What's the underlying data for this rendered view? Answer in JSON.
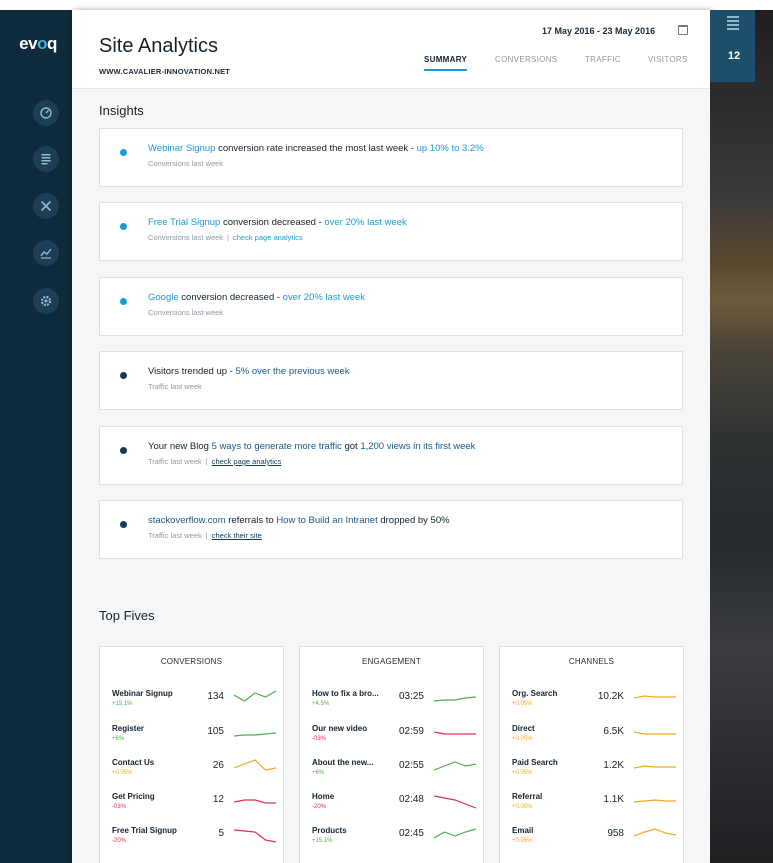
{
  "brand": {
    "logo_a": "ev",
    "logo_o": "o",
    "logo_b": "q"
  },
  "header": {
    "title": "Site Analytics",
    "site_url": "WWW.CAVALIER-INNOVATION.NET",
    "date_range": "17 May 2016 - 23 May 2016",
    "tabs": [
      {
        "label": "SUMMARY",
        "active": true
      },
      {
        "label": "CONVERSIONS",
        "active": false
      },
      {
        "label": "TRAFFIC",
        "active": false
      },
      {
        "label": "VISITORS",
        "active": false
      }
    ]
  },
  "sidebar": {
    "icons": [
      "dashboard-icon",
      "document-list-icon",
      "tools-icon",
      "analytics-chart-icon",
      "settings-gear-icon"
    ]
  },
  "insights": {
    "title": "Insights",
    "cards": [
      {
        "bullet": "light",
        "parts": [
          {
            "t": "Webinar Signup",
            "c": "hl-l"
          },
          {
            "t": " conversion rate increased the most last week - ",
            "c": ""
          },
          {
            "t": "up 10% to 3.2%",
            "c": "hl-l"
          }
        ],
        "sub": "Conversions last week",
        "link": "",
        "link_style": ""
      },
      {
        "bullet": "light",
        "parts": [
          {
            "t": "Free Trial Signup",
            "c": "hl-l"
          },
          {
            "t": " conversion decreased - ",
            "c": ""
          },
          {
            "t": "over 20% last week",
            "c": "hl-l"
          }
        ],
        "sub": "Conversions last week",
        "link": "check page analytics",
        "link_style": "link-l"
      },
      {
        "bullet": "light",
        "parts": [
          {
            "t": "Google",
            "c": "hl-l"
          },
          {
            "t": " conversion decreased - ",
            "c": ""
          },
          {
            "t": "over 20% last week",
            "c": "hl-l"
          }
        ],
        "sub": "Conversions last week",
        "link": "",
        "link_style": ""
      },
      {
        "bullet": "dark",
        "parts": [
          {
            "t": "Visitors trended up - ",
            "c": ""
          },
          {
            "t": "5% over the previous week",
            "c": "hl-d"
          }
        ],
        "sub": "Traffic last week",
        "link": "",
        "link_style": ""
      },
      {
        "bullet": "dark",
        "parts": [
          {
            "t": "Your new Blog ",
            "c": ""
          },
          {
            "t": "5 ways to generate more traffic",
            "c": "hl-d"
          },
          {
            "t": " got ",
            "c": ""
          },
          {
            "t": "1,200 views in its first week",
            "c": "hl-d"
          }
        ],
        "sub": "Traffic last week",
        "link": "check page analytics",
        "link_style": "link-d"
      },
      {
        "bullet": "dark",
        "parts": [
          {
            "t": "stackoverflow.com",
            "c": "hl-d"
          },
          {
            "t": " referrals to ",
            "c": ""
          },
          {
            "t": "How to Build an Intranet",
            "c": "hl-d"
          },
          {
            "t": " dropped by 50%",
            "c": ""
          }
        ],
        "sub": "Traffic last week",
        "link": "check their site",
        "link_style": "link-d"
      }
    ]
  },
  "top_fives": {
    "title": "Top Fives",
    "panels": [
      {
        "title": "CONVERSIONS",
        "rows": [
          {
            "name": "Webinar Signup",
            "change": "+15.1%",
            "trend": "green",
            "value": "134",
            "spark": [
              6,
              12,
              4,
              8,
              2
            ]
          },
          {
            "name": "Register",
            "change": "+6%",
            "trend": "green",
            "value": "105",
            "spark": [
              12,
              11,
              11,
              10,
              9
            ]
          },
          {
            "name": "Contact Us",
            "change": "+0.05%",
            "trend": "orange",
            "value": "26",
            "spark": [
              10,
              6,
              2,
              12,
              10
            ]
          },
          {
            "name": "Get Pricing",
            "change": "-03%",
            "trend": "red",
            "value": "12",
            "spark": [
              10,
              8,
              8,
              11,
              11
            ]
          },
          {
            "name": "Free Trial Signup",
            "change": "-20%",
            "trend": "red",
            "value": "5",
            "spark": [
              4,
              5,
              6,
              14,
              16
            ]
          }
        ]
      },
      {
        "title": "ENGAGEMENT",
        "rows": [
          {
            "name": "How to fix a bro...",
            "change": "+4.5%",
            "trend": "green",
            "value": "03:25",
            "spark": [
              12,
              11,
              11,
              9,
              8
            ]
          },
          {
            "name": "Our new video",
            "change": "-03%",
            "trend": "red",
            "value": "02:59",
            "spark": [
              8,
              10,
              10,
              10,
              10
            ]
          },
          {
            "name": "About the new...",
            "change": "+6%",
            "trend": "green",
            "value": "02:55",
            "spark": [
              12,
              8,
              4,
              8,
              6
            ]
          },
          {
            "name": "Home",
            "change": "-20%",
            "trend": "red",
            "value": "02:48",
            "spark": [
              4,
              6,
              8,
              12,
              16
            ]
          },
          {
            "name": "Products",
            "change": "+15.1%",
            "trend": "green",
            "value": "02:45",
            "spark": [
              12,
              6,
              10,
              6,
              3
            ]
          }
        ]
      },
      {
        "title": "CHANNELS",
        "rows": [
          {
            "name": "Org. Search",
            "change": "+0.05%",
            "trend": "orange",
            "value": "10.2K",
            "spark": [
              9,
              7,
              8,
              8,
              8
            ]
          },
          {
            "name": "Direct",
            "change": "+0.05%",
            "trend": "orange",
            "value": "6.5K",
            "spark": [
              8,
              10,
              10,
              10,
              10
            ]
          },
          {
            "name": "Paid Search",
            "change": "+0.05%",
            "trend": "orange",
            "value": "1.2K",
            "spark": [
              10,
              8,
              9,
              9,
              9
            ]
          },
          {
            "name": "Referral",
            "change": "+0.05%",
            "trend": "orange",
            "value": "1.1K",
            "spark": [
              10,
              9,
              8,
              9,
              9
            ]
          },
          {
            "name": "Email",
            "change": "+0.05%",
            "trend": "orange",
            "value": "958",
            "spark": [
              10,
              6,
              3,
              7,
              9
            ]
          }
        ]
      }
    ]
  },
  "right_panel": {
    "count": "12"
  },
  "colors": {
    "accent": "#1b9bd1",
    "navy": "#123a57",
    "green": "#4caf50",
    "red": "#e0304e",
    "orange": "#f0a81e"
  }
}
